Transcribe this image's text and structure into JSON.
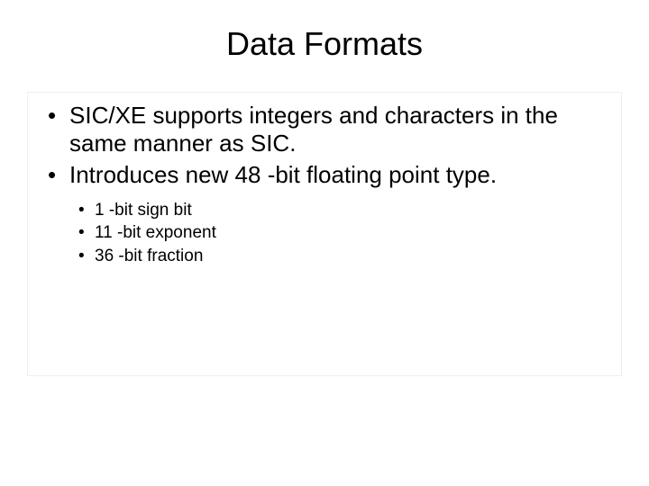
{
  "title": "Data Formats",
  "main_bullets": [
    "SIC/XE supports integers and characters in the same manner as SIC.",
    "Introduces new 48 -bit floating point type."
  ],
  "sub_bullets": [
    "1 -bit sign bit",
    "11 -bit exponent",
    "36 -bit fraction"
  ]
}
